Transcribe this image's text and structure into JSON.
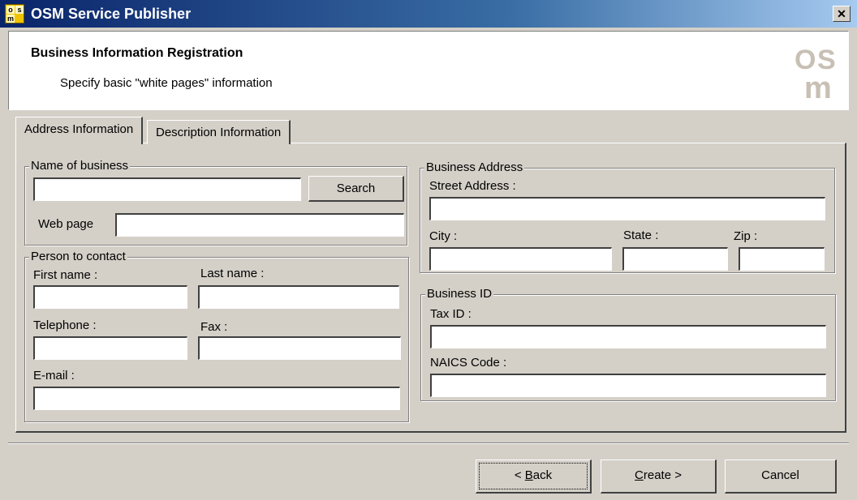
{
  "window": {
    "title": "OSM Service Publisher",
    "close_glyph": "✕"
  },
  "header": {
    "title": "Business Information Registration",
    "subtitle": "Specify basic \"white pages\" information",
    "logo_text": [
      "O",
      "S",
      "m"
    ]
  },
  "tabs": [
    {
      "label": "Address Information",
      "active": true
    },
    {
      "label": "Description Information",
      "active": false
    }
  ],
  "name_group": {
    "legend": "Name of business",
    "business_name": "",
    "search_label": "Search",
    "webpage_label": "Web page",
    "webpage_value": ""
  },
  "contact_group": {
    "legend": "Person to contact",
    "first_name_label": "First name :",
    "last_name_label": "Last name :",
    "telephone_label": "Telephone :",
    "fax_label": "Fax :",
    "email_label": "E-mail :",
    "first_name": "",
    "last_name": "",
    "telephone": "",
    "fax": "",
    "email": ""
  },
  "address_group": {
    "legend": "Business Address",
    "street_label": "Street Address :",
    "city_label": "City :",
    "state_label": "State :",
    "zip_label": "Zip :",
    "street": "",
    "city": "",
    "state": "",
    "zip": ""
  },
  "id_group": {
    "legend": "Business ID",
    "tax_label": "Tax ID :",
    "naics_label": "NAICS Code :",
    "tax_id": "",
    "naics": ""
  },
  "footer": {
    "back_prefix": "< ",
    "back_mnemonic": "B",
    "back_rest": "ack",
    "create_mnemonic": "C",
    "create_rest": "reate >",
    "cancel_label": "Cancel"
  },
  "colors": {
    "face": "#d4d0c8",
    "title_start": "#0a246a",
    "title_end": "#a6caf0",
    "logo": "#c8c0b4"
  }
}
